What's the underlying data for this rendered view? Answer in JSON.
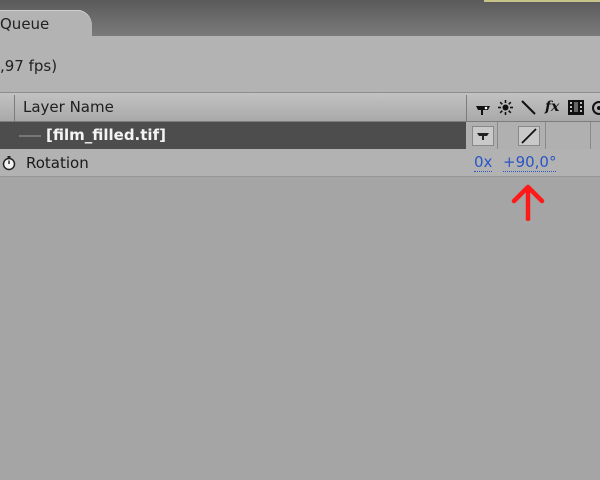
{
  "panel": {
    "tab_label": "Queue",
    "comp_info": ",97 fps)"
  },
  "timeline": {
    "column_header": "Layer Name",
    "header_icons": [
      "shy-icon",
      "collapse-icon",
      "quality-icon",
      "fx-icon",
      "frame-blend-icon",
      "motion-blur-icon"
    ],
    "header_fx_glyph": "fx",
    "layer": {
      "name": "[film_filled.tif]"
    },
    "property": {
      "name": "Rotation",
      "revolutions": "0x",
      "degrees": "+90,0°"
    }
  },
  "annotation": {
    "arrow_color": "#ff1a1a"
  },
  "colors": {
    "value_blue": "#2b55c6",
    "layer_bar": "#4d4d4d",
    "panel_bg": "#b3b3b3"
  }
}
